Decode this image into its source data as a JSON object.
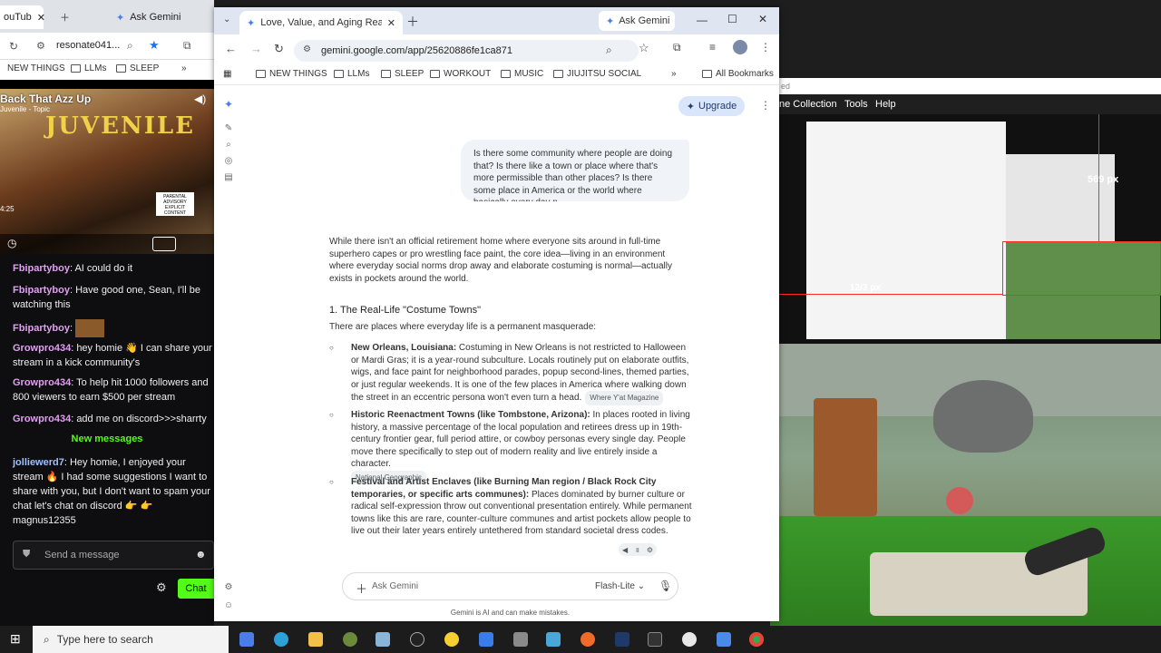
{
  "left_window": {
    "tabs": [
      "ouTub",
      "Ask Gemini"
    ],
    "address": "resonate041...",
    "bookmarks": [
      "NEW THINGS",
      "LLMs",
      "SLEEP"
    ],
    "video": {
      "title": "Back That Azz Up",
      "channel": "Juvenile - Topic",
      "time": "4:25",
      "advisory": "PARENTAL ADVISORY EXPLICIT CONTENT"
    },
    "chat": {
      "messages": [
        {
          "user": "Fbipartyboy",
          "text": "AI could do it"
        },
        {
          "user": "Fbipartyboy",
          "text": "Have good one, Sean, I'll be watching this"
        },
        {
          "user": "Fbipartyboy",
          "text": ""
        },
        {
          "user": "Growpro434",
          "text": "hey homie 👋 I can share your stream in a kick community's"
        },
        {
          "user": "Growpro434",
          "text": "To help hit 1000 followers and 800 viewers to earn $500 per stream"
        },
        {
          "user": "Growpro434",
          "text": "add me on discord>>>sharrty"
        }
      ],
      "new_messages_label": "New messages",
      "last_message": {
        "user": "jolliewerd7",
        "text": "Hey homie, I enjoyed your stream 🔥 I had some suggestions I want to share with you, but I don't want to spam your chat let's chat on discord 👉 👉 magnus12355"
      },
      "input_placeholder": "Send a message",
      "chat_button": "Chat"
    }
  },
  "gemini_window": {
    "tab_title": "Love, Value, and Aging Realitie",
    "right_tab": "Ask Gemini",
    "url": "gemini.google.com/app/25620886fe1ca871",
    "bookmarks": [
      "NEW THINGS",
      "LLMs",
      "SLEEP",
      "WORKOUT",
      "MUSIC",
      "JIUJITSU SOCIAL"
    ],
    "all_bookmarks": "All Bookmarks",
    "upgrade": "Upgrade",
    "user_prompt": "Is there some community where people are doing that? Is there like a town or place where that's more permissible than other places? Is there some place in America or the world where basically every day n",
    "intro": "While there isn't an official retirement home where everyone sits around in full-time superhero capes or pro wrestling face paint, the core idea—living in an environment where everyday social norms drop away and elaborate costuming is normal—actually exists in pockets around the world.",
    "section_heading": "1. The Real-Life \"Costume Towns\"",
    "section_sub": "There are places where everyday life is a permanent masquerade:",
    "bullets": [
      {
        "title": "New Orleans, Louisiana:",
        "text": " Costuming in New Orleans is not restricted to Halloween or Mardi Gras; it is a year-round subculture. Locals routinely put on elaborate outfits, wigs, and face paint for neighborhood parades, popup second-lines, themed parties, or just regular weekends. It is one of the few places in America where walking down the street in an eccentric persona won't even turn a head.",
        "source": "Where Y'at Magazine"
      },
      {
        "title": "Historic Reenactment Towns (like Tombstone, Arizona):",
        "text": " In places rooted in living history, a massive percentage of the local population and retirees dress up in 19th-century frontier gear, full period attire, or cowboy personas every single day. People move there specifically to step out of modern reality and live entirely inside a character.",
        "source": "National Geographic"
      },
      {
        "title": "Festival and Artist Enclaves (like Burning Man region / Black Rock City temporaries, or specific arts communes):",
        "text": " Places dominated by burner culture or radical self-expression throw out conventional presentation entirely. While permanent towns like this are rare, counter-culture communes and artist pockets allow people to live out their later years entirely untethered from standard societal dress codes.",
        "source": ""
      }
    ],
    "ask_placeholder": "Ask Gemini",
    "model": "Flash-Lite",
    "disclaimer": "Gemini is AI and can make mistakes."
  },
  "right_app": {
    "menu": [
      "ne Collection",
      "Tools",
      "Help"
    ],
    "top_text": "ed",
    "overlay_text_1": "569 px",
    "overlay_text_2": "12/3 px"
  },
  "taskbar": {
    "search_placeholder": "Type here to search"
  }
}
